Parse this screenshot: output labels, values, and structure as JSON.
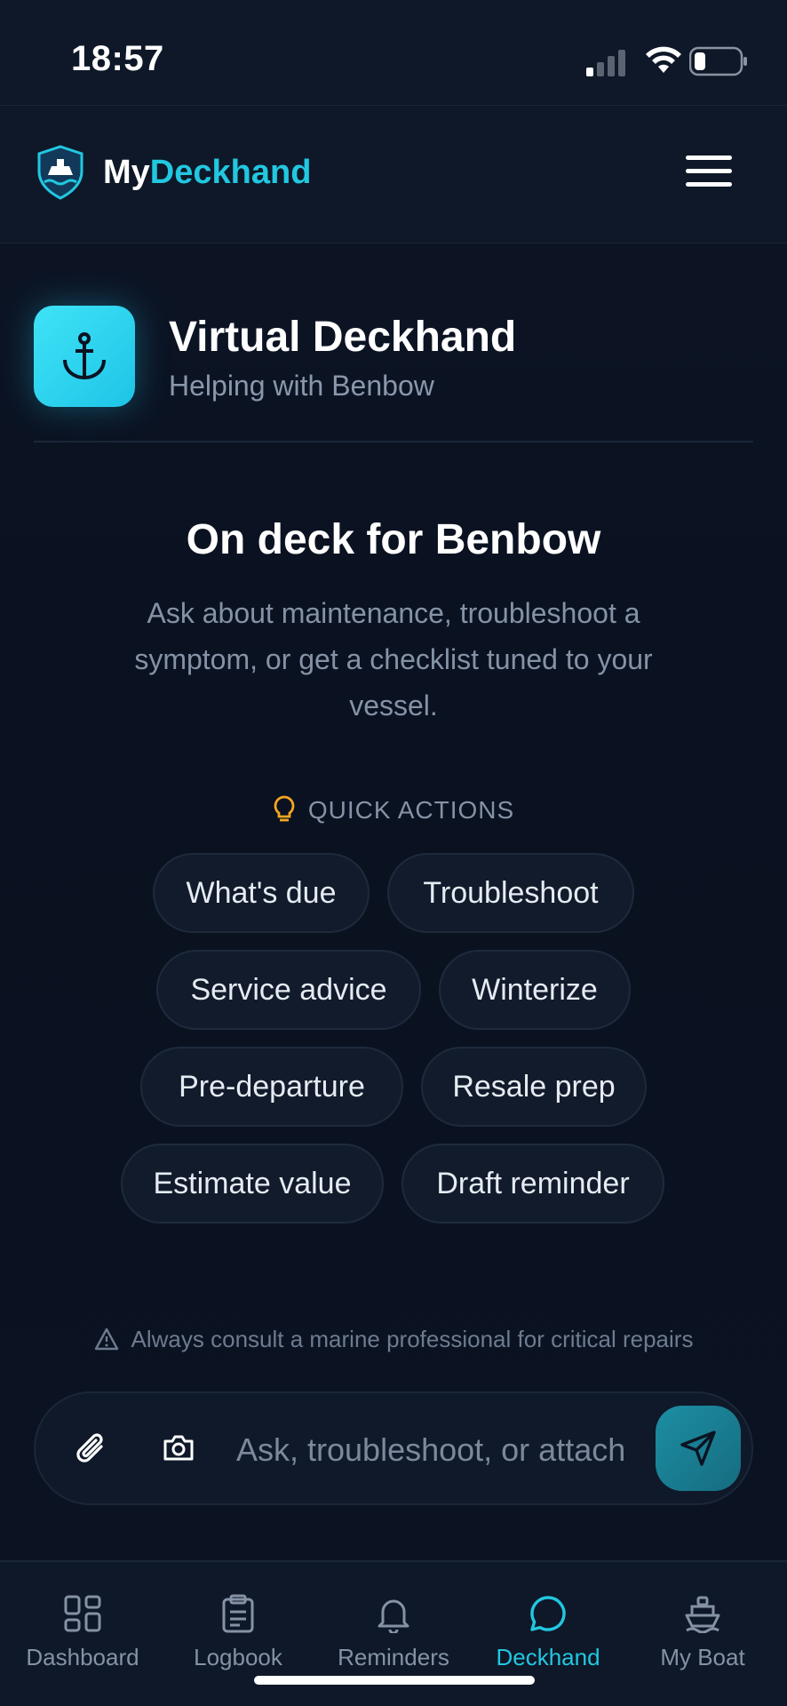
{
  "status_bar": {
    "time": "18:57"
  },
  "header": {
    "brand_prefix": "My",
    "brand_suffix": "Deckhand",
    "logo_icon": "ship-shield-icon",
    "menu_icon": "hamburger-menu-icon"
  },
  "assistant": {
    "title": "Virtual Deckhand",
    "subtitle": "Helping with Benbow",
    "icon": "anchor-icon"
  },
  "hero": {
    "title": "On deck for Benbow",
    "description": "Ask about maintenance, troubleshoot a symptom, or get a checklist tuned to your vessel."
  },
  "quick_actions": {
    "label": "QUICK ACTIONS",
    "chips": [
      "What's due",
      "Troubleshoot",
      "Service advice",
      "Winterize",
      "Pre-departure",
      "Resale prep",
      "Estimate value",
      "Draft reminder"
    ]
  },
  "disclaimer": "Always consult a marine professional for critical repairs",
  "composer": {
    "placeholder": "Ask, troubleshoot, or attach"
  },
  "bottom_nav": {
    "items": [
      {
        "label": "Dashboard",
        "icon": "grid-icon"
      },
      {
        "label": "Logbook",
        "icon": "clipboard-icon"
      },
      {
        "label": "Reminders",
        "icon": "bell-icon"
      },
      {
        "label": "Deckhand",
        "icon": "chat-bubble-icon",
        "active": true
      },
      {
        "label": "My Boat",
        "icon": "boat-icon"
      }
    ]
  },
  "colors": {
    "accent": "#22c7e0",
    "background": "#0b1322",
    "warning": "#f5a623"
  }
}
